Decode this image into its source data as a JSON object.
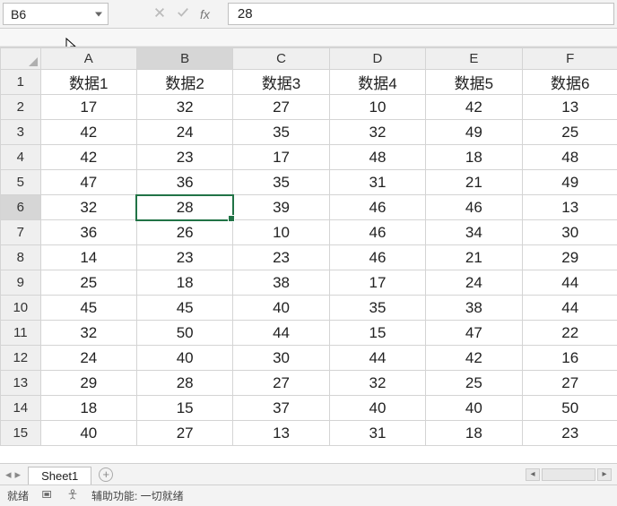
{
  "formula_bar": {
    "cell_ref": "B6",
    "fx_label": "fx",
    "value": "28"
  },
  "columns": [
    "A",
    "B",
    "C",
    "D",
    "E",
    "F"
  ],
  "row_numbers": [
    1,
    2,
    3,
    4,
    5,
    6,
    7,
    8,
    9,
    10,
    11,
    12,
    13,
    14,
    15
  ],
  "headers": [
    "数据1",
    "数据2",
    "数据3",
    "数据4",
    "数据5",
    "数据6"
  ],
  "rows": [
    [
      17,
      32,
      27,
      10,
      42,
      13
    ],
    [
      42,
      24,
      35,
      32,
      49,
      25
    ],
    [
      42,
      23,
      17,
      48,
      18,
      48
    ],
    [
      47,
      36,
      35,
      31,
      21,
      49
    ],
    [
      32,
      28,
      39,
      46,
      46,
      13
    ],
    [
      36,
      26,
      10,
      46,
      34,
      30
    ],
    [
      14,
      23,
      23,
      46,
      21,
      29
    ],
    [
      25,
      18,
      38,
      17,
      24,
      44
    ],
    [
      45,
      45,
      40,
      35,
      38,
      44
    ],
    [
      32,
      50,
      44,
      15,
      47,
      22
    ],
    [
      24,
      40,
      30,
      44,
      42,
      16
    ],
    [
      29,
      28,
      27,
      32,
      25,
      27
    ],
    [
      18,
      15,
      37,
      40,
      40,
      50
    ],
    [
      40,
      27,
      13,
      31,
      18,
      23
    ]
  ],
  "selected": {
    "col_index": 1,
    "row_index": 5
  },
  "tabs": {
    "sheet_name": "Sheet1"
  },
  "status": {
    "ready": "就绪",
    "acc": "辅助功能: 一切就绪"
  },
  "chart_data": {
    "type": "table",
    "title": "",
    "columns": [
      "数据1",
      "数据2",
      "数据3",
      "数据4",
      "数据5",
      "数据6"
    ],
    "rows": [
      [
        17,
        32,
        27,
        10,
        42,
        13
      ],
      [
        42,
        24,
        35,
        32,
        49,
        25
      ],
      [
        42,
        23,
        17,
        48,
        18,
        48
      ],
      [
        47,
        36,
        35,
        31,
        21,
        49
      ],
      [
        32,
        28,
        39,
        46,
        46,
        13
      ],
      [
        36,
        26,
        10,
        46,
        34,
        30
      ],
      [
        14,
        23,
        23,
        46,
        21,
        29
      ],
      [
        25,
        18,
        38,
        17,
        24,
        44
      ],
      [
        45,
        45,
        40,
        35,
        38,
        44
      ],
      [
        32,
        50,
        44,
        15,
        47,
        22
      ],
      [
        24,
        40,
        30,
        44,
        42,
        16
      ],
      [
        29,
        28,
        27,
        32,
        25,
        27
      ],
      [
        18,
        15,
        37,
        40,
        40,
        50
      ],
      [
        40,
        27,
        13,
        31,
        18,
        23
      ]
    ]
  }
}
